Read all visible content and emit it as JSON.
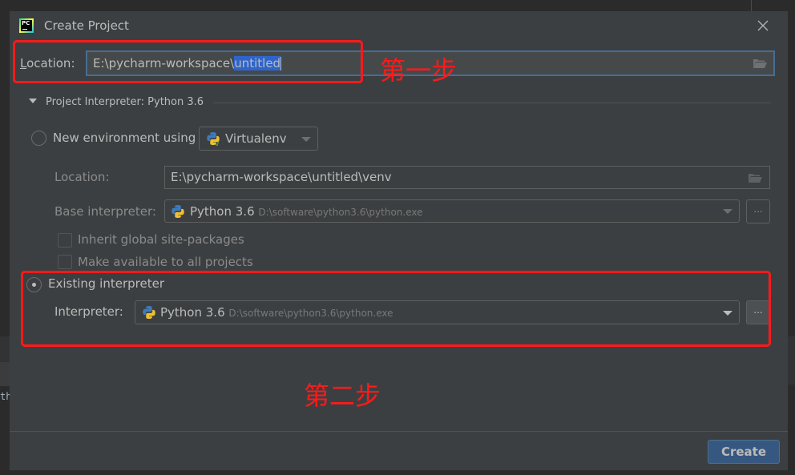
{
  "background_ide": {
    "partial_text": "th"
  },
  "dialog": {
    "title": "Create Project",
    "location": {
      "label_first_letter": "L",
      "label_rest": "ocation:",
      "value_prefix": "E:\\pycharm-workspace\\",
      "value_selected": "untitled"
    },
    "interpreter_section": {
      "title": "Project Interpreter: Python 3.6",
      "expanded": true
    },
    "new_environment": {
      "label": "New environment using",
      "selected": false,
      "tool": "Virtualenv",
      "location_label": "Location:",
      "location_value": "E:\\pycharm-workspace\\untitled\\venv",
      "base_interpreter_label": "Base interpreter:",
      "base_interpreter_name": "Python 3.6",
      "base_interpreter_path": "D:\\software\\python3.6\\python.exe",
      "inherit_label": "Inherit global site-packages",
      "inherit_checked": false,
      "make_available_label": "Make available to all projects",
      "make_available_checked": false,
      "browse_label": "..."
    },
    "existing_interpreter": {
      "label": "Existing interpreter",
      "selected": true,
      "interpreter_label": "Interpreter:",
      "interpreter_name": "Python 3.6",
      "interpreter_path": "D:\\software\\python3.6\\python.exe",
      "browse_label": "..."
    },
    "create_button": "Create"
  },
  "annotations": {
    "step1": "第一步",
    "step2": "第二步",
    "color": "#ff1a1a"
  },
  "colors": {
    "dialog_bg": "#3c3f41",
    "accent_border": "#466d94",
    "selection": "#2f65ca",
    "button_primary": "#365880"
  }
}
